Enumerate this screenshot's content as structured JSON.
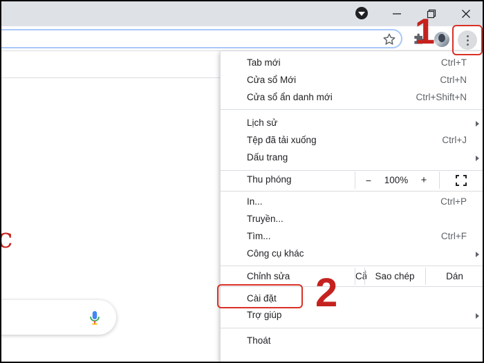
{
  "menu": {
    "items": [
      {
        "label": "Tab mới",
        "shortcut": "Ctrl+T"
      },
      {
        "label": "Cửa sổ Mới",
        "shortcut": "Ctrl+N"
      },
      {
        "label": "Cửa sổ ẩn danh mới",
        "shortcut": "Ctrl+Shift+N"
      },
      {
        "label": "Lịch sử",
        "shortcut": ""
      },
      {
        "label": "Tệp đã tải xuống",
        "shortcut": "Ctrl+J"
      },
      {
        "label": "Dấu trang",
        "shortcut": ""
      },
      {
        "label": "In...",
        "shortcut": "Ctrl+P"
      },
      {
        "label": "Truyền...",
        "shortcut": ""
      },
      {
        "label": "Tìm...",
        "shortcut": "Ctrl+F"
      },
      {
        "label": "Công cụ khác",
        "shortcut": ""
      },
      {
        "label": "Cài đặt",
        "shortcut": ""
      },
      {
        "label": "Trợ giúp",
        "shortcut": ""
      },
      {
        "label": "Thoát",
        "shortcut": ""
      }
    ],
    "zoom": {
      "label": "Thu phóng",
      "minus": "−",
      "value": "100%",
      "plus": "+"
    },
    "edit": {
      "label": "Chỉnh sửa",
      "cut": "Cắt",
      "copy": "Sao chép",
      "paste": "Dán"
    }
  },
  "annotations": {
    "step1": "1",
    "step2": "2"
  },
  "page": {
    "glyph": "c"
  },
  "icons": {
    "profile": "profile-dropdown-icon",
    "minimize": "minimize-icon",
    "restore": "restore-icon",
    "close": "close-icon",
    "star": "star-icon",
    "extensions": "puzzle-icon",
    "menu": "kebab-menu-icon",
    "fullscreen": "fullscreen-icon",
    "mic": "microphone-icon"
  },
  "colors": {
    "annotation": "#d93025",
    "titlebar": "#dee1e6",
    "omnibox_focus": "#a8c7fa"
  }
}
